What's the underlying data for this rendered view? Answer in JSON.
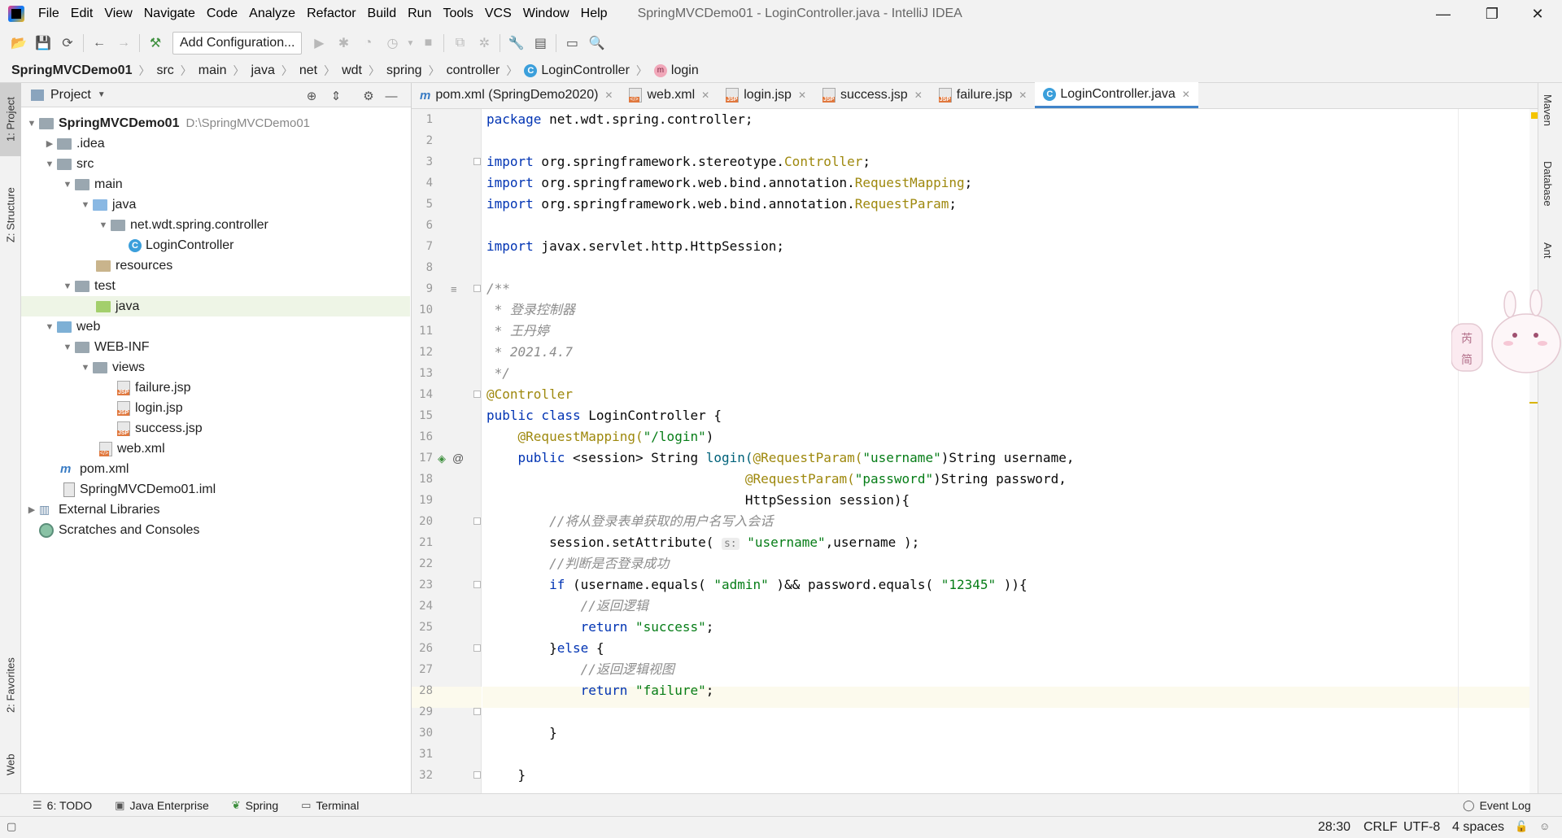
{
  "window": {
    "title": "SpringMVCDemo01 - LoginController.java - IntelliJ IDEA",
    "menu": [
      "File",
      "Edit",
      "View",
      "Navigate",
      "Code",
      "Analyze",
      "Refactor",
      "Build",
      "Run",
      "Tools",
      "VCS",
      "Window",
      "Help"
    ],
    "controls": {
      "minimize": "—",
      "restore": "❐",
      "close": "✕"
    }
  },
  "toolbar": {
    "run_config_label": "Add Configuration..."
  },
  "breadcrumb": [
    "SpringMVCDemo01",
    "src",
    "main",
    "java",
    "net",
    "wdt",
    "spring",
    "controller",
    "LoginController",
    "login"
  ],
  "left_stripe": {
    "project": "1: Project",
    "structure": "Z: Structure",
    "favorites": "2: Favorites",
    "web": "Web"
  },
  "project_panel": {
    "title": "Project",
    "tree": [
      {
        "label": "SpringMVCDemo01",
        "path": "D:\\SpringMVCDemo01"
      },
      {
        "label": ".idea"
      },
      {
        "label": "src"
      },
      {
        "label": "main"
      },
      {
        "label": "java"
      },
      {
        "label": "net.wdt.spring.controller"
      },
      {
        "label": "LoginController"
      },
      {
        "label": "resources"
      },
      {
        "label": "test"
      },
      {
        "label": "java"
      },
      {
        "label": "web"
      },
      {
        "label": "WEB-INF"
      },
      {
        "label": "views"
      },
      {
        "label": "failure.jsp"
      },
      {
        "label": "login.jsp"
      },
      {
        "label": "success.jsp"
      },
      {
        "label": "web.xml"
      },
      {
        "label": "pom.xml"
      },
      {
        "label": "SpringMVCDemo01.iml"
      },
      {
        "label": "External Libraries"
      },
      {
        "label": "Scratches and Consoles"
      }
    ]
  },
  "editor_tabs": [
    "pom.xml (SpringDemo2020)",
    "web.xml",
    "login.jsp",
    "success.jsp",
    "failure.jsp",
    "LoginController.java"
  ],
  "editor": {
    "line_numbers": [
      "1",
      "2",
      "3",
      "4",
      "5",
      "6",
      "7",
      "8",
      "9",
      "10",
      "11",
      "12",
      "13",
      "14",
      "15",
      "16",
      "17",
      "18",
      "19",
      "20",
      "21",
      "22",
      "23",
      "24",
      "25",
      "26",
      "27",
      "28",
      "29",
      "30",
      "31",
      "32"
    ],
    "code": {
      "l1a": "package",
      "l1b": " net.wdt.spring.controller;",
      "l3a": "import",
      "l3b": " org.springframework.stereotype.",
      "l3c": "Controller",
      "l3d": ";",
      "l4a": "import",
      "l4b": " org.springframework.web.bind.annotation.",
      "l4c": "RequestMapping",
      "l4d": ";",
      "l5a": "import",
      "l5b": " org.springframework.web.bind.annotation.",
      "l5c": "RequestParam",
      "l5d": ";",
      "l7a": "import",
      "l7b": " javax.servlet.http.HttpSession;",
      "l9": "/**",
      "l10": " * 登录控制器",
      "l11": " * 王丹婷",
      "l12": " * 2021.4.7",
      "l13": " */",
      "l14": "@Controller",
      "l15a": "public class",
      "l15b": " LoginController {",
      "l16a": "    @RequestMapping(",
      "l16b": "\"/login\"",
      "l16c": ")",
      "l17a": "    public",
      "l17b": " <session>",
      "l17c": " String ",
      "l17d": "login(",
      "l17e": "@RequestParam(",
      "l17f": "\"username\"",
      "l17g": ")String username,",
      "l18a": "                                 @RequestParam(",
      "l18b": "\"password\"",
      "l18c": ")String password,",
      "l19": "                                 HttpSession session){",
      "l20": "        //将从登录表单获取的用户名写入会话",
      "l21a": "        session.setAttribute( ",
      "l21hint": "s:",
      "l21b": " \"username\"",
      "l21c": ",username );",
      "l22": "        //判断是否登录成功",
      "l23a": "        if",
      "l23b": " (username.equals( ",
      "l23c": "\"admin\"",
      "l23d": " )&& password.equals( ",
      "l23e": "\"12345\"",
      "l23f": " )){",
      "l24": "            //返回逻辑",
      "l25a": "            return",
      "l25b": " \"success\"",
      "l25c": ";",
      "l26a": "        }",
      "l26b": "else",
      "l26c": " {",
      "l27": "            //返回逻辑视图",
      "l28a": "            return",
      "l28b": " \"failure\"",
      "l28c": ";",
      "l30": "        }",
      "l32": "    }"
    }
  },
  "right_stripe": {
    "maven": "Maven",
    "database": "Database",
    "ant": "Ant"
  },
  "sticker_text": [
    "芮",
    "简"
  ],
  "bottom_tools": {
    "todo": "6: TODO",
    "java_enterprise": "Java Enterprise",
    "spring": "Spring",
    "terminal": "Terminal",
    "event_log": "Event Log"
  },
  "status": {
    "position": "28:30",
    "line_sep": "CRLF",
    "encoding": "UTF-8",
    "indent": "4 spaces"
  }
}
